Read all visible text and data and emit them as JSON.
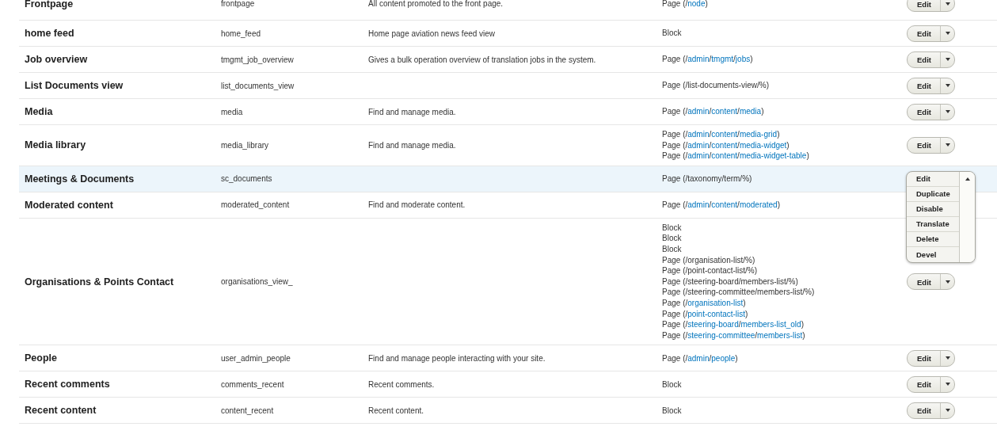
{
  "rows": [
    {
      "name": "Frontpage",
      "machine_name": "frontpage",
      "description": "All content promoted to the front page.",
      "highlighted": false,
      "expanded": false,
      "operations": [
        "Edit"
      ],
      "displays": [
        [
          {
            "text": "Page (/",
            "link": false
          },
          {
            "text": "node",
            "link": true
          },
          {
            "text": ")",
            "link": false
          }
        ]
      ]
    },
    {
      "name": "home feed",
      "machine_name": "home_feed",
      "description": "Home page aviation news feed view",
      "highlighted": false,
      "expanded": false,
      "operations": [
        "Edit"
      ],
      "displays": [
        [
          {
            "text": "Block",
            "link": false
          }
        ]
      ]
    },
    {
      "name": "Job overview",
      "machine_name": "tmgmt_job_overview",
      "description": "Gives a bulk operation overview of translation jobs in the system.",
      "highlighted": false,
      "expanded": false,
      "operations": [
        "Edit"
      ],
      "displays": [
        [
          {
            "text": "Page (/",
            "link": false
          },
          {
            "text": "admin",
            "link": true
          },
          {
            "text": "/",
            "link": false
          },
          {
            "text": "tmgmt",
            "link": true
          },
          {
            "text": "/",
            "link": false
          },
          {
            "text": "jobs",
            "link": true
          },
          {
            "text": ")",
            "link": false
          }
        ]
      ]
    },
    {
      "name": "List Documents view",
      "machine_name": "list_documents_view",
      "description": "",
      "highlighted": false,
      "expanded": false,
      "operations": [
        "Edit"
      ],
      "displays": [
        [
          {
            "text": "Page (/list-documents-view/%)",
            "link": false
          }
        ]
      ]
    },
    {
      "name": "Media",
      "machine_name": "media",
      "description": "Find and manage media.",
      "highlighted": false,
      "expanded": false,
      "operations": [
        "Edit"
      ],
      "displays": [
        [
          {
            "text": "Page (/",
            "link": false
          },
          {
            "text": "admin",
            "link": true
          },
          {
            "text": "/",
            "link": false
          },
          {
            "text": "content",
            "link": true
          },
          {
            "text": "/",
            "link": false
          },
          {
            "text": "media",
            "link": true
          },
          {
            "text": ")",
            "link": false
          }
        ]
      ]
    },
    {
      "name": "Media library",
      "machine_name": "media_library",
      "description": "Find and manage media.",
      "highlighted": false,
      "expanded": false,
      "operations": [
        "Edit"
      ],
      "displays": [
        [
          {
            "text": "Page (/",
            "link": false
          },
          {
            "text": "admin",
            "link": true
          },
          {
            "text": "/",
            "link": false
          },
          {
            "text": "content",
            "link": true
          },
          {
            "text": "/",
            "link": false
          },
          {
            "text": "media-grid",
            "link": true
          },
          {
            "text": ")",
            "link": false
          }
        ],
        [
          {
            "text": "Page (/",
            "link": false
          },
          {
            "text": "admin",
            "link": true
          },
          {
            "text": "/",
            "link": false
          },
          {
            "text": "content",
            "link": true
          },
          {
            "text": "/",
            "link": false
          },
          {
            "text": "media-widget",
            "link": true
          },
          {
            "text": ")",
            "link": false
          }
        ],
        [
          {
            "text": "Page (/",
            "link": false
          },
          {
            "text": "admin",
            "link": true
          },
          {
            "text": "/",
            "link": false
          },
          {
            "text": "content",
            "link": true
          },
          {
            "text": "/",
            "link": false
          },
          {
            "text": "media-widget-table",
            "link": true
          },
          {
            "text": ")",
            "link": false
          }
        ]
      ]
    },
    {
      "name": "Meetings & Documents",
      "machine_name": "sc_documents",
      "description": "",
      "highlighted": true,
      "expanded": true,
      "operations": [
        "Edit",
        "Duplicate",
        "Disable",
        "Translate",
        "Delete",
        "Devel"
      ],
      "displays": [
        [
          {
            "text": "Page (/taxonomy/term/%)",
            "link": false
          }
        ]
      ]
    },
    {
      "name": "Moderated content",
      "machine_name": "moderated_content",
      "description": "Find and moderate content.",
      "highlighted": false,
      "operations": [],
      "displays": [
        [
          {
            "text": "Page (/",
            "link": false
          },
          {
            "text": "admin",
            "link": true
          },
          {
            "text": "/",
            "link": false
          },
          {
            "text": "content",
            "link": true
          },
          {
            "text": "/",
            "link": false
          },
          {
            "text": "moderated",
            "link": true
          },
          {
            "text": ")",
            "link": false
          }
        ]
      ]
    },
    {
      "name": "Organisations & Points Contact",
      "machine_name": "organisations_view_",
      "description": "",
      "highlighted": false,
      "expanded": false,
      "operations": [
        "Edit"
      ],
      "displays": [
        [
          {
            "text": "Block",
            "link": false
          }
        ],
        [
          {
            "text": "Block",
            "link": false
          }
        ],
        [
          {
            "text": "Block",
            "link": false
          }
        ],
        [
          {
            "text": "Page (/organisation-list/%)",
            "link": false
          }
        ],
        [
          {
            "text": "Page (/point-contact-list/%)",
            "link": false
          }
        ],
        [
          {
            "text": "Page (/steering-board/members-list/%)",
            "link": false
          }
        ],
        [
          {
            "text": "Page (/steering-committee/members-list/%)",
            "link": false
          }
        ],
        [
          {
            "text": "Page (/",
            "link": false
          },
          {
            "text": "organisation-list",
            "link": true
          },
          {
            "text": ")",
            "link": false
          }
        ],
        [
          {
            "text": "Page (/",
            "link": false
          },
          {
            "text": "point-contact-list",
            "link": true
          },
          {
            "text": ")",
            "link": false
          }
        ],
        [
          {
            "text": "Page (/",
            "link": false
          },
          {
            "text": "steering-board",
            "link": true
          },
          {
            "text": "/",
            "link": false
          },
          {
            "text": "members-list_old",
            "link": true
          },
          {
            "text": ")",
            "link": false
          }
        ],
        [
          {
            "text": "Page (/",
            "link": false
          },
          {
            "text": "steering-committee",
            "link": true
          },
          {
            "text": "/",
            "link": false
          },
          {
            "text": "members-list",
            "link": true
          },
          {
            "text": ")",
            "link": false
          }
        ]
      ]
    },
    {
      "name": "People",
      "machine_name": "user_admin_people",
      "description": "Find and manage people interacting with your site.",
      "highlighted": false,
      "expanded": false,
      "operations": [
        "Edit"
      ],
      "displays": [
        [
          {
            "text": "Page (/",
            "link": false
          },
          {
            "text": "admin",
            "link": true
          },
          {
            "text": "/",
            "link": false
          },
          {
            "text": "people",
            "link": true
          },
          {
            "text": ")",
            "link": false
          }
        ]
      ]
    },
    {
      "name": "Recent comments",
      "machine_name": "comments_recent",
      "description": "Recent comments.",
      "highlighted": false,
      "expanded": false,
      "operations": [
        "Edit"
      ],
      "displays": [
        [
          {
            "text": "Block",
            "link": false
          }
        ]
      ]
    },
    {
      "name": "Recent content",
      "machine_name": "content_recent",
      "description": "Recent content.",
      "highlighted": false,
      "expanded": false,
      "operations": [
        "Edit"
      ],
      "displays": [
        [
          {
            "text": "Block",
            "link": false
          }
        ]
      ]
    }
  ]
}
